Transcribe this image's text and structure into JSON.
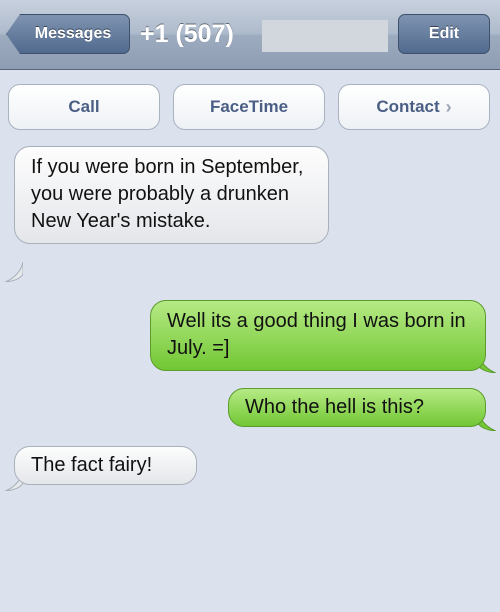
{
  "nav": {
    "back_label": "Messages",
    "title": "+1 (507)",
    "edit_label": "Edit"
  },
  "actions": {
    "call": "Call",
    "facetime": "FaceTime",
    "contact": "Contact",
    "chevron_icon": "chevron-right-icon"
  },
  "messages": [
    {
      "direction": "received",
      "text": "If you were born in September, you were probably a drunken New Year's mistake."
    },
    {
      "direction": "sent",
      "text": "Well its a good thing I was born in July. =]"
    },
    {
      "direction": "sent",
      "text": "Who the hell is this?"
    },
    {
      "direction": "received",
      "text": "The fact fairy!"
    }
  ],
  "colors": {
    "background": "#dbe2ed",
    "sent_bubble": "#8fd54f",
    "received_bubble": "#f2f3f5",
    "action_text": "#4b5f85"
  }
}
